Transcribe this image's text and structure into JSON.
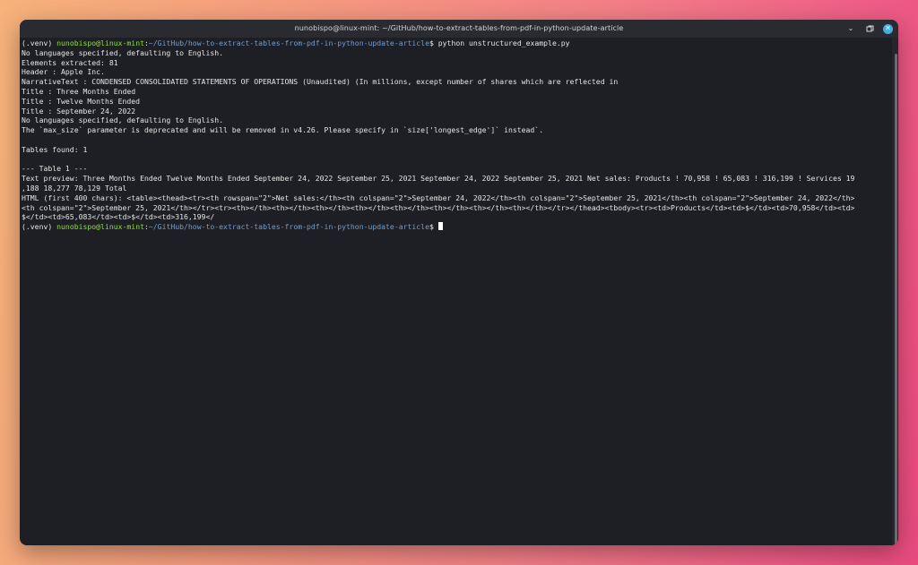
{
  "window": {
    "title": "nunobispo@linux-mint: ~/GitHub/how-to-extract-tables-from-pdf-in-python-update-article",
    "controls": {
      "minimize": "minimize-icon",
      "maximize": "maximize-icon",
      "close": "close-icon"
    }
  },
  "terminal": {
    "prompt1": {
      "venv": "(.venv) ",
      "user": "nunobispo@linux-mint",
      "colon": ":",
      "path": "~/GitHub/how-to-extract-tables-from-pdf-in-python-update-article",
      "symbol": "$ ",
      "command": "python unstructured_example.py"
    },
    "output": [
      "No languages specified, defaulting to English.",
      "Elements extracted: 81",
      "Header : Apple Inc.",
      "NarrativeText : CONDENSED CONSOLIDATED STATEMENTS OF OPERATIONS (Unaudited) (In millions, except number of shares which are reflected in",
      "Title : Three Months Ended",
      "Title : Twelve Months Ended",
      "Title : September 24, 2022",
      "No languages specified, defaulting to English.",
      "The `max_size` parameter is deprecated and will be removed in v4.26. Please specify in `size['longest_edge']` instead`.",
      "",
      "Tables found: 1",
      "",
      "--- Table 1 ---",
      "Text preview: Three Months Ended Twelve Months Ended September 24, 2022 September 25, 2021 September 24, 2022 September 25, 2021 Net sales: Products ! 70,958 ! 65,083 ! 316,199 ! Services 19",
      ",188 18,277 78,129 Total",
      "HTML (first 400 chars): <table><thead><tr><th rowspan=\"2\">Net sales:</th><th colspan=\"2\">September 24, 2022</th><th colspan=\"2\">September 25, 2021</th><th colspan=\"2\">September 24, 2022</th>",
      "<th colspan=\"2\">September 25, 2021</th></tr><tr><th></th><th></th><th></th><th></th><th></th><th></th><th></th><th></th></tr></thead><tbody><tr><td>Products</td><td>",
      "$</td><td>65,083</td><td>$</td><td>316,199</"
    ],
    "prompt2": {
      "venv": "(.venv) ",
      "user": "nunobispo@linux-mint",
      "colon": ":",
      "path": "~/GitHub/how-to-extract-tables-from-pdf-in-python-update-article",
      "symbol": "$ "
    },
    "html_line2_tail": "$</td><td>70,958</td><td>"
  },
  "colors": {
    "background": "#1e1f24",
    "prompt_user": "#8ae234",
    "prompt_path": "#729fcf",
    "close_button": "#3daee9"
  }
}
